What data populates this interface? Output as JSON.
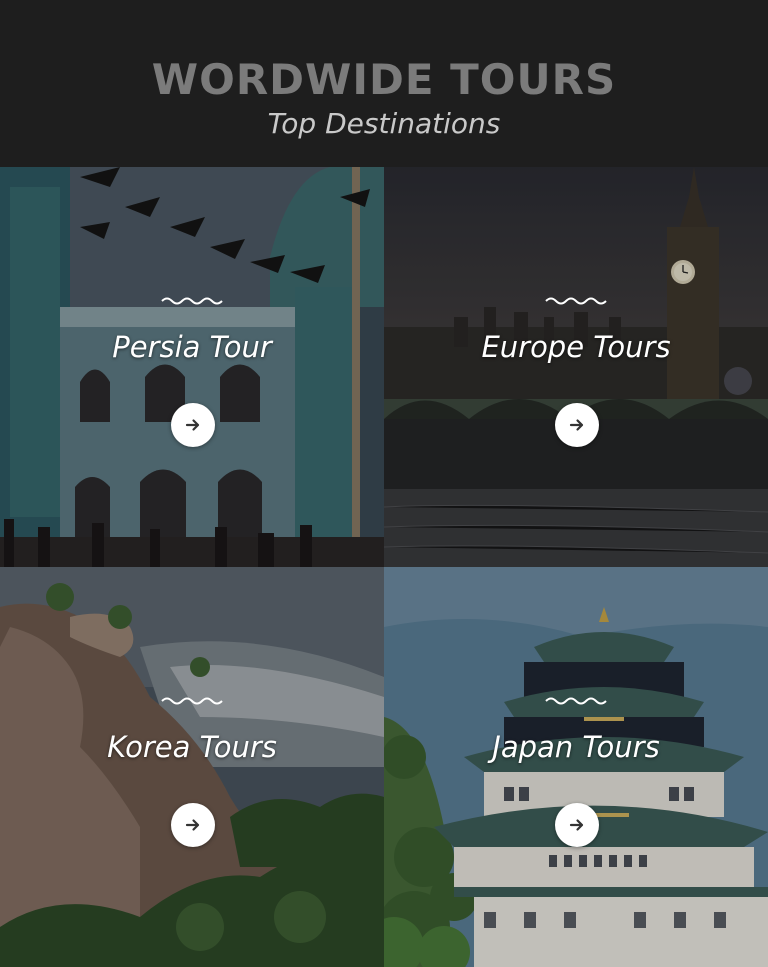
{
  "header": {
    "brand": "WORDWIDE TOURS",
    "subtitle": "Top Destinations"
  },
  "tours": [
    {
      "title": "Persia Tour",
      "button_icon": "arrow-right-icon"
    },
    {
      "title": "Europe Tours",
      "button_icon": "arrow-right-icon"
    },
    {
      "title": "Korea Tours",
      "button_icon": "arrow-right-icon"
    },
    {
      "title": "Japan Tours",
      "button_icon": "arrow-right-icon"
    }
  ],
  "colors": {
    "header_bg": "#1e1e1e",
    "brand_text": "#7b7b7b",
    "subtitle_text": "#c9c9c9",
    "button_bg": "#ffffff",
    "icon": "#333333"
  }
}
